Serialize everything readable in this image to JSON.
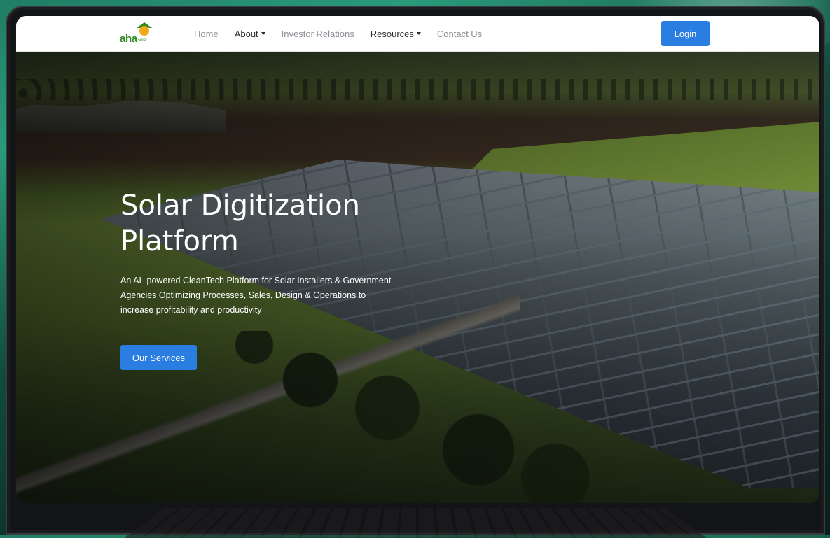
{
  "brand": {
    "name": "aha",
    "sub": "solar"
  },
  "nav": {
    "items": [
      {
        "label": "Home",
        "dropdown": false
      },
      {
        "label": "About",
        "dropdown": true
      },
      {
        "label": "Investor Relations",
        "dropdown": false
      },
      {
        "label": "Resources",
        "dropdown": true
      },
      {
        "label": "Contact Us",
        "dropdown": false
      }
    ],
    "login_label": "Login"
  },
  "hero": {
    "title_line1": "Solar Digitization",
    "title_line2": "Platform",
    "description": "An AI- powered CleanTech Platform for Solar Installers & Government Agencies Optimizing Processes, Sales, Design & Operations to increase profitability and productivity",
    "cta_label": "Our Services"
  },
  "colors": {
    "primary": "#2a7de1",
    "brand_green": "#2e8b22",
    "brand_orange": "#f1a817",
    "nav_text": "#8a8f95"
  }
}
